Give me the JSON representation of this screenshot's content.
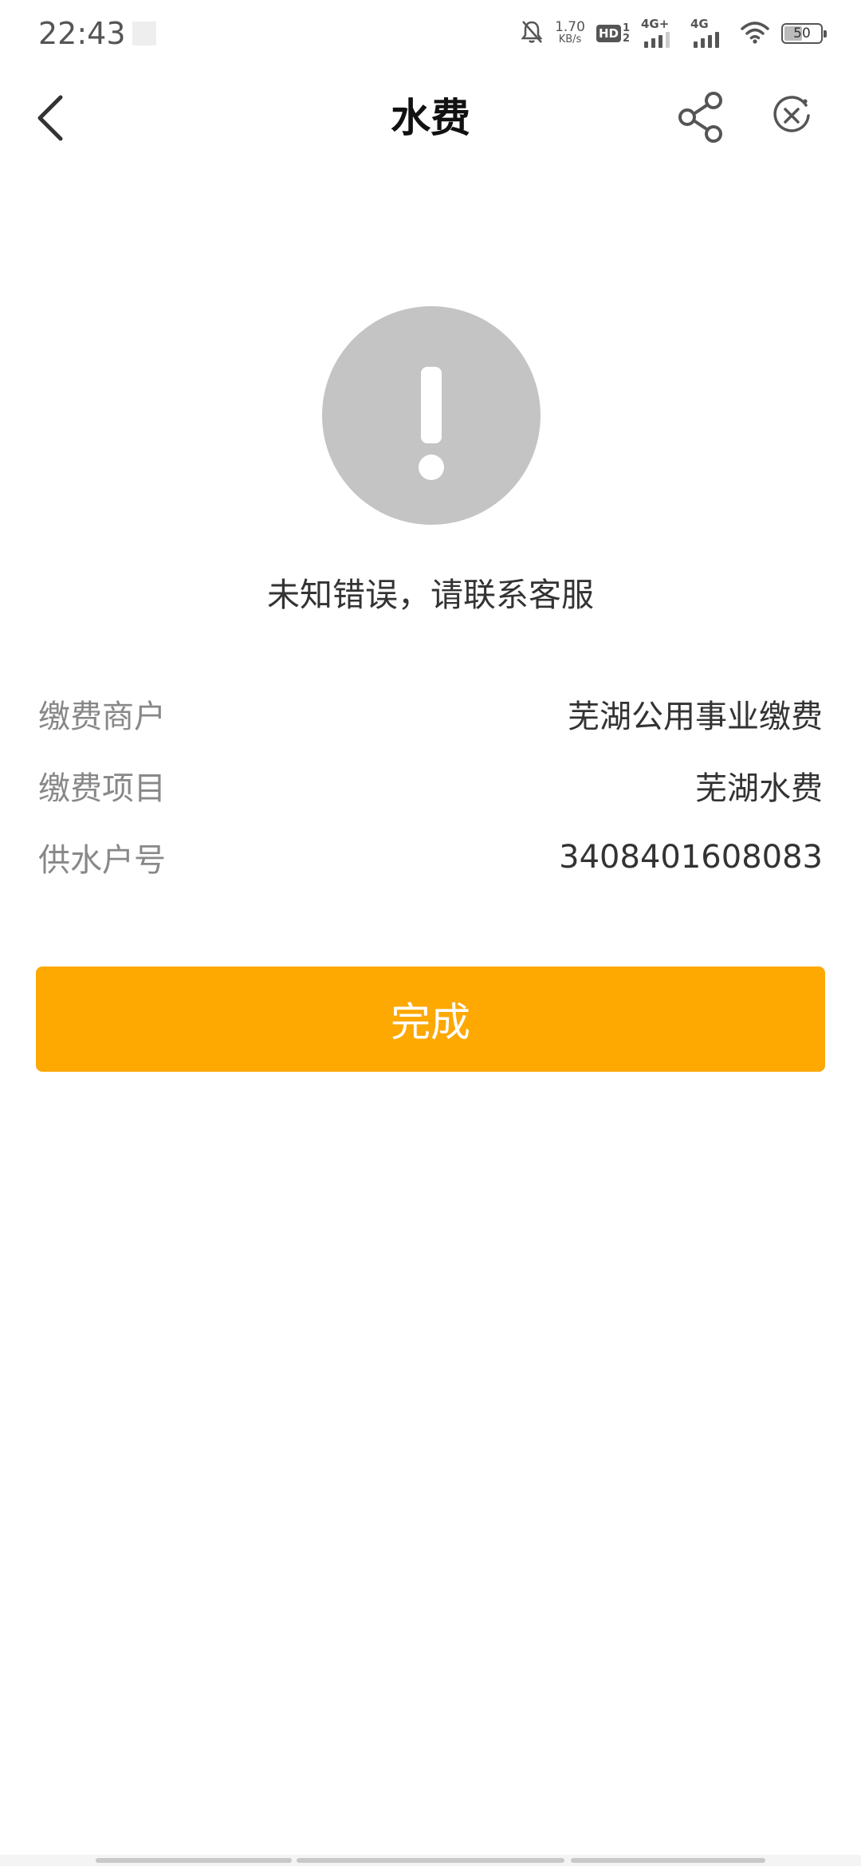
{
  "status_bar": {
    "time": "22:43",
    "net_speed_value": "1.70",
    "net_speed_unit": "KB/s",
    "hd_label": "HD",
    "hd_sim_1": "1",
    "hd_sim_2": "2",
    "signal_1_label": "4G+",
    "signal_2_label": "4G",
    "battery_level": "50",
    "icons": [
      "mute-bell-icon",
      "wifi-icon",
      "battery-icon"
    ]
  },
  "nav": {
    "title": "水费",
    "back_icon": "chevron-left-icon",
    "share_icon": "share-icon",
    "close_icon": "close-circle-icon"
  },
  "result": {
    "icon": "exclamation-icon",
    "message": "未知错误，请联系客服"
  },
  "details": [
    {
      "label": "缴费商户",
      "value": "芜湖公用事业缴费"
    },
    {
      "label": "缴费项目",
      "value": "芜湖水费"
    },
    {
      "label": "供水户号",
      "value": "3408401608083"
    }
  ],
  "actions": {
    "done_label": "完成"
  },
  "colors": {
    "accent": "#fea802",
    "icon_gray": "#c4c4c4",
    "label_gray": "#888888",
    "text_dark": "#333333"
  }
}
